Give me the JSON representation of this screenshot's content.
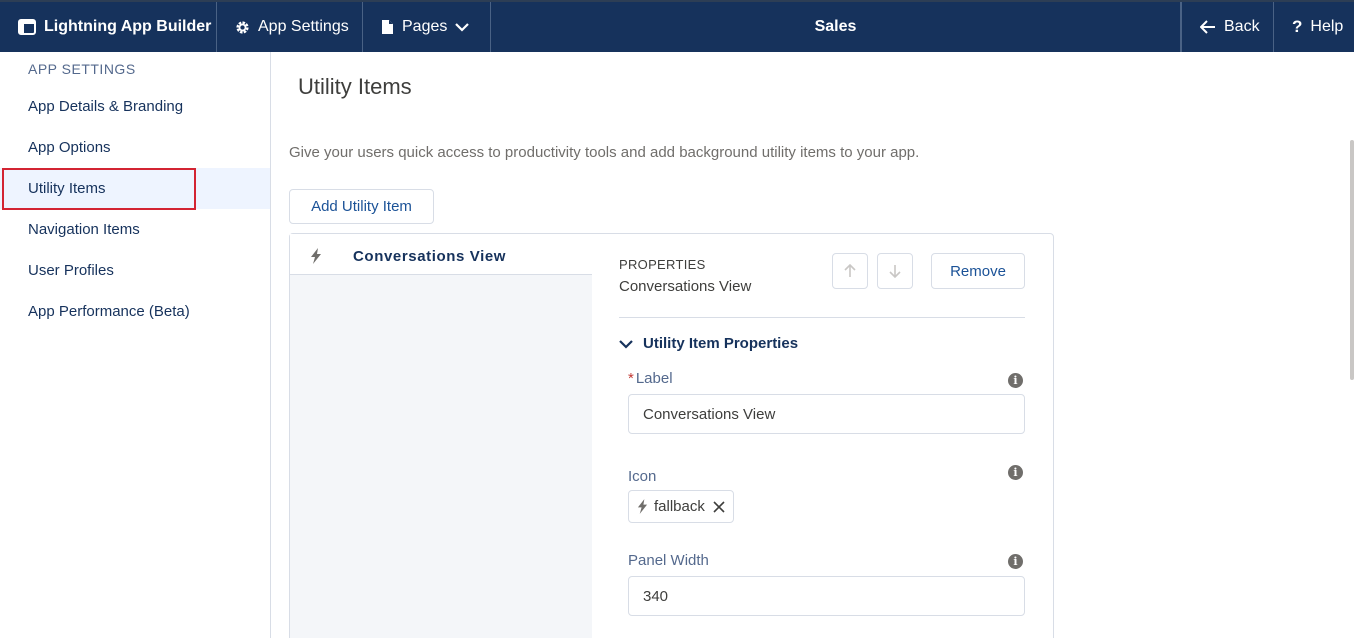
{
  "topbar": {
    "brand": "Lightning App Builder",
    "app_settings": "App Settings",
    "pages": "Pages",
    "title": "Sales",
    "back": "Back",
    "help": "Help",
    "background": "#16325c"
  },
  "sidebar": {
    "header": "APP SETTINGS",
    "items": [
      {
        "label": "App Details & Branding"
      },
      {
        "label": "App Options"
      },
      {
        "label": "Utility Items"
      },
      {
        "label": "Navigation Items"
      },
      {
        "label": "User Profiles"
      },
      {
        "label": "App Performance (Beta)"
      }
    ],
    "active_index": 2,
    "highlight_color": "#d32432"
  },
  "main": {
    "title": "Utility Items",
    "description": "Give your users quick access to productivity tools and add background utility items to your app.",
    "add_button": "Add Utility Item",
    "list": [
      {
        "label": "Conversations View",
        "icon": "bolt-icon"
      }
    ],
    "properties": {
      "caption": "PROPERTIES",
      "name": "Conversations View",
      "remove_button": "Remove",
      "section_title": "Utility Item Properties",
      "label_field": {
        "label": "Label",
        "required": "*",
        "value": "Conversations View"
      },
      "icon_field": {
        "label": "Icon",
        "value": "fallback"
      },
      "width_field": {
        "label": "Panel Width",
        "value": "340"
      }
    }
  }
}
